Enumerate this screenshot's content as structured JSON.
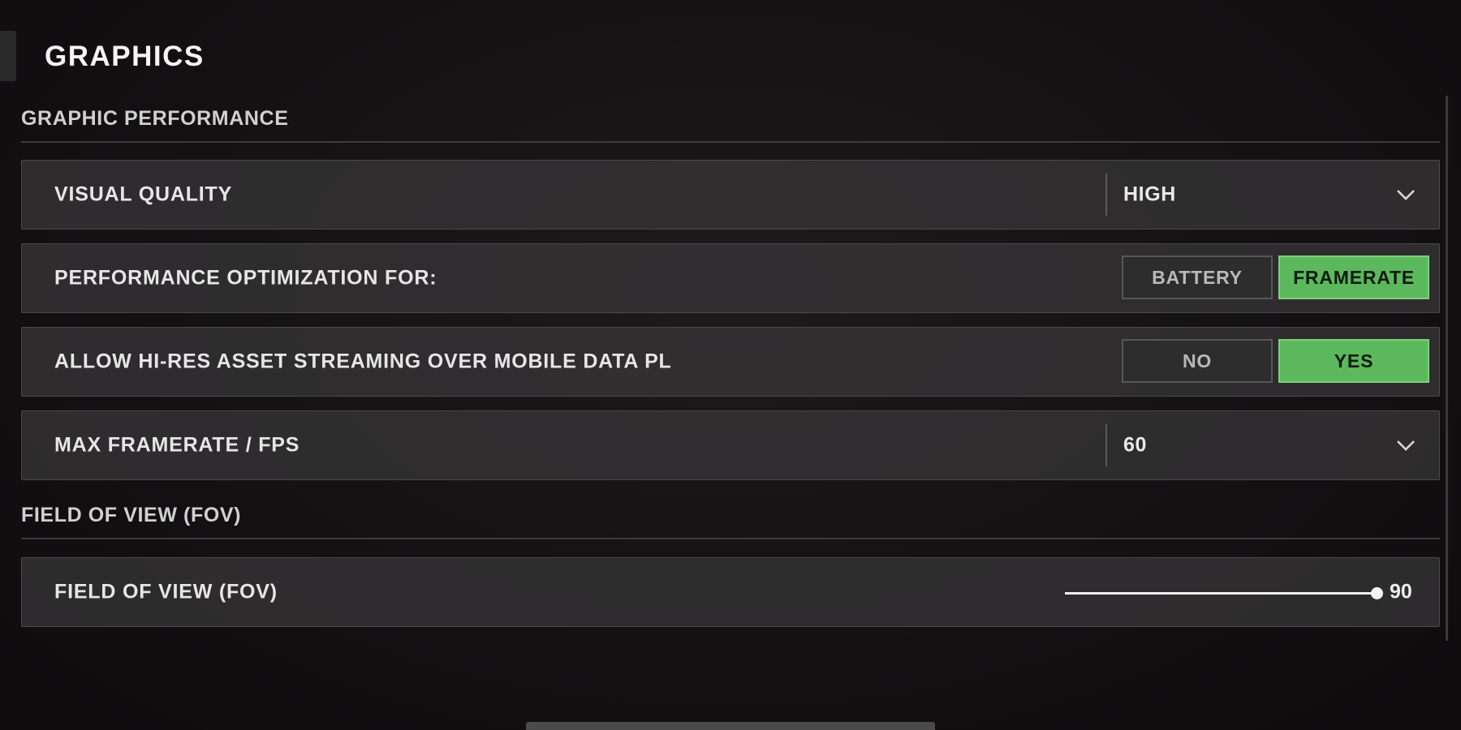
{
  "page": {
    "title": "GRAPHICS"
  },
  "sections": {
    "performance": {
      "header": "GRAPHIC PERFORMANCE"
    },
    "fov": {
      "header": "FIELD OF VIEW (FOV)"
    }
  },
  "settings": {
    "visual_quality": {
      "label": "VISUAL QUALITY",
      "value": "HIGH"
    },
    "performance_optimization": {
      "label": "PERFORMANCE OPTIMIZATION FOR:",
      "options": [
        "BATTERY",
        "FRAMERATE"
      ],
      "selected": "FRAMERATE"
    },
    "hires_streaming": {
      "label": "ALLOW HI-RES ASSET STREAMING OVER MOBILE DATA PL",
      "options": [
        "NO",
        "YES"
      ],
      "selected": "YES"
    },
    "max_framerate": {
      "label": "MAX FRAMERATE / FPS",
      "value": "60"
    },
    "field_of_view": {
      "label": "FIELD OF VIEW (FOV)",
      "value": "90",
      "fill_fraction": 1.0
    }
  },
  "icons": {
    "dropdown": "chevron-down-icon"
  },
  "colors": {
    "selected_toggle": "#5cb85c",
    "background": "#141113"
  }
}
